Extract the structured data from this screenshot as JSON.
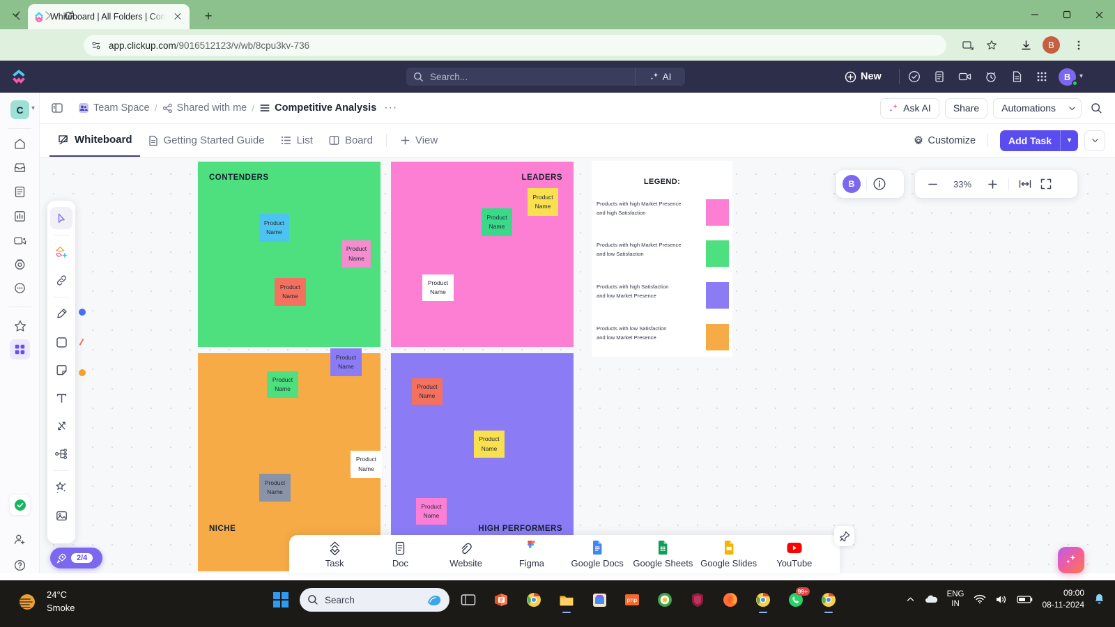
{
  "browser": {
    "tab_title": "Whiteboard | All Folders | Conte",
    "url_bold": "app.clickup.com",
    "url_rest": "/9016512123/v/wb/8cpu3kv-736",
    "profile_initial": "B",
    "icons": {
      "tab_list": "chevron-down-icon",
      "favicon": "clickup-favicon",
      "close": "tab-close-icon",
      "new_tab": "new-tab-icon",
      "back": "back-arrow-icon",
      "forward": "forward-arrow-icon",
      "reload": "reload-icon",
      "site_info": "site-settings-icon",
      "install": "install-app-icon",
      "bookmark": "bookmark-star-icon",
      "downloads": "downloads-icon",
      "menu": "browser-menu-icon",
      "minimize": "minimize-icon",
      "maximize": "maximize-icon",
      "close_window": "window-close-icon"
    }
  },
  "clickup_header": {
    "search_placeholder": "Search...",
    "ai_label": "AI",
    "new_label": "New",
    "avatar_initial": "B",
    "icons": [
      "checkmark-circle-icon",
      "clipboard-icon",
      "video-camera-icon",
      "alarm-clock-icon",
      "document-icon",
      "apps-grid-icon"
    ]
  },
  "rail": {
    "workspace_initial": "C",
    "items": [
      {
        "name": "home-icon"
      },
      {
        "name": "inbox-icon"
      },
      {
        "name": "docs-icon"
      },
      {
        "name": "dashboards-icon"
      },
      {
        "name": "clips-icon"
      },
      {
        "name": "timer-icon"
      },
      {
        "name": "more-icon"
      },
      {
        "name": "favorites-star-icon"
      },
      {
        "name": "apps-grid-icon"
      }
    ],
    "bottom": [
      {
        "name": "task-complete-icon"
      },
      {
        "name": "invite-user-icon"
      },
      {
        "name": "help-icon"
      }
    ]
  },
  "breadcrumb": {
    "items": [
      {
        "label": "Team Space",
        "icon": "team-space-icon"
      },
      {
        "label": "Shared with me",
        "icon": "share-icon"
      },
      {
        "label": "Competitive Analysis",
        "icon": "list-lines-icon"
      }
    ],
    "separator": "/",
    "more": "···",
    "ask_ai": "Ask AI",
    "share": "Share",
    "automations": "Automations"
  },
  "view_tabs": [
    {
      "label": "Whiteboard",
      "icon": "whiteboard-icon",
      "active": true
    },
    {
      "label": "Getting Started Guide",
      "icon": "guide-doc-icon",
      "active": false
    },
    {
      "label": "List",
      "icon": "list-icon",
      "active": false
    },
    {
      "label": "Board",
      "icon": "board-icon",
      "active": false
    },
    {
      "label": "View",
      "icon": "plus-icon",
      "active": false
    }
  ],
  "view_actions": {
    "customize": "Customize",
    "add_task": "Add Task"
  },
  "whiteboard": {
    "tools": [
      {
        "name": "select-cursor-tool",
        "active": true
      },
      {
        "name": "shapes-add-tool",
        "active": false
      },
      {
        "name": "link-tool",
        "active": false
      },
      {
        "name": "highlighter-pen-tool",
        "active": false
      },
      {
        "name": "rectangle-shape-tool",
        "active": false
      },
      {
        "name": "sticky-note-tool",
        "active": false
      },
      {
        "name": "text-tool",
        "active": false
      },
      {
        "name": "connector-tool",
        "active": false
      },
      {
        "name": "mindmap-tool",
        "active": false
      },
      {
        "name": "magic-wand-ai-tool",
        "active": false
      },
      {
        "name": "image-tool",
        "active": false
      }
    ],
    "collab_avatar": "B",
    "zoom_level": "33%",
    "quadrants": [
      {
        "id": "contenders",
        "label": "CONTENDERS",
        "color": "#4ee07f",
        "label_align": "left",
        "notes": [
          {
            "text_line1": "Product",
            "text_line2": "Name",
            "color": "#4dc3f2"
          },
          {
            "text_line1": "Product",
            "text_line2": "Name",
            "color": "#f58cd0"
          },
          {
            "text_line1": "Product",
            "text_line2": "Name",
            "color": "#f4705f"
          }
        ]
      },
      {
        "id": "leaders",
        "label": "LEADERS",
        "color": "#fd7fd3",
        "label_align": "right",
        "notes": [
          {
            "text_line1": "Product",
            "text_line2": "Name",
            "color": "#f9e04e"
          },
          {
            "text_line1": "Product",
            "text_line2": "Name",
            "color": "#3ad98a"
          },
          {
            "text_line1": "Product",
            "text_line2": "Name",
            "color": "#ffffff"
          }
        ]
      },
      {
        "id": "niche",
        "label": "NICHE",
        "color": "#f7ab46",
        "label_align": "left",
        "notes": [
          {
            "text_line1": "Product",
            "text_line2": "Name",
            "color": "#8b7cf6"
          },
          {
            "text_line1": "Product",
            "text_line2": "Name",
            "color": "#4ee07f"
          },
          {
            "text_line1": "Product",
            "text_line2": "Name",
            "color": "#ffffff"
          },
          {
            "text_line1": "Product",
            "text_line2": "Name",
            "color": "#8a93a8"
          }
        ]
      },
      {
        "id": "high-performers",
        "label": "HIGH PERFORMERS",
        "color": "#8b7cf6",
        "label_align": "right",
        "notes": [
          {
            "text_line1": "Product",
            "text_line2": "Name",
            "color": "#f4705f"
          },
          {
            "text_line1": "Product",
            "text_line2": "Name",
            "color": "#f9e04e"
          },
          {
            "text_line1": "Product",
            "text_line2": "Name",
            "color": "#fd7fd3"
          }
        ]
      }
    ],
    "legend": {
      "title": "LEGEND:",
      "rows": [
        {
          "line1": "Products with high Market Presence",
          "line2": "and high Satisfaction",
          "color": "#fd7fd3"
        },
        {
          "line1": "Products with high Market Presence",
          "line2": "and low Satisfaction",
          "color": "#4ee07f"
        },
        {
          "line1": "Products with high Satisfaction",
          "line2": "and low Market Presence",
          "color": "#8b7cf6"
        },
        {
          "line1": "Products with low Satisfaction",
          "line2": "and low Market Presence",
          "color": "#f7ab46"
        }
      ]
    }
  },
  "object_bar": [
    {
      "label": "Task",
      "icon": "clickup-task-icon"
    },
    {
      "label": "Doc",
      "icon": "doc-icon"
    },
    {
      "label": "Website",
      "icon": "link-website-icon"
    },
    {
      "label": "Figma",
      "icon": "figma-icon"
    },
    {
      "label": "Google Docs",
      "icon": "google-docs-icon"
    },
    {
      "label": "Google Sheets",
      "icon": "google-sheets-icon"
    },
    {
      "label": "Google Slides",
      "icon": "google-slides-icon"
    },
    {
      "label": "YouTube",
      "icon": "youtube-icon"
    }
  ],
  "onboarding": {
    "progress": "2/4",
    "icon": "rocket-icon"
  },
  "taskbar": {
    "weather_temp": "24°C",
    "weather_desc": "Smoke",
    "search_label": "Search",
    "language": "ENG",
    "region": "IN",
    "time": "09:00",
    "date": "08-11-2024",
    "notification_badge": "99+",
    "apps": [
      "start-windows-icon",
      "task-view-icon",
      "microsoft-office-icon",
      "chrome-icon",
      "file-explorer-icon",
      "store-icon",
      "xampp-icon",
      "browser-icon",
      "shield-app-icon",
      "firefox-icon",
      "chrome-beta-icon",
      "whatsapp-icon",
      "chrome-canary-icon"
    ]
  }
}
